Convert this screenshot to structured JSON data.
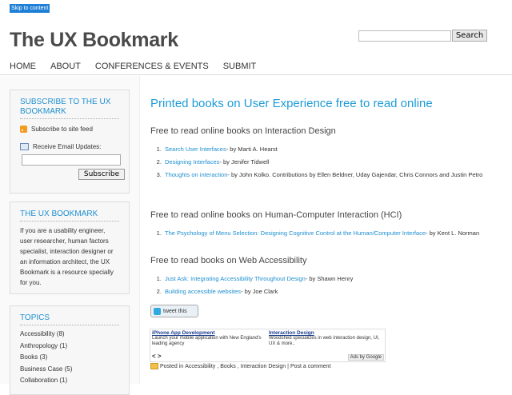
{
  "skip_link": "Skip to content",
  "header": {
    "title": "The UX Bookmark",
    "search_placeholder": "",
    "search_button": "Search"
  },
  "nav": [
    "HOME",
    "ABOUT",
    "CONFERENCES & EVENTS",
    "SUBMIT"
  ],
  "sidebar": {
    "subscribe": {
      "title": "SUBSCRIBE TO THE UX BOOKMARK",
      "feed": "Subscribe to site feed",
      "email": "Receive Email Updates:",
      "button": "Subscribe"
    },
    "about": {
      "title": "THE UX BOOKMARK",
      "text": "If you are a usability engineer, user researcher, human factors specialist, interaction designer or an information architect, the UX Bookmark is a resource specially for you."
    },
    "topics": {
      "title": "TOPICS",
      "items": [
        "Accessibility (8)",
        "Anthropology (1)",
        "Books (3)",
        "Business Case (5)",
        "Collaboration (1)"
      ]
    }
  },
  "main": {
    "title": "Printed books on User Experience free to read online",
    "sections": [
      {
        "heading": "Free to read online books on Interaction Design",
        "items": [
          {
            "link": "Search User Interfaces",
            "rest": "- by Marti A. Hearst"
          },
          {
            "link": "Designing Interfaces",
            "rest": "- by Jenifer Tidwell"
          },
          {
            "link": "Thoughts on interaction",
            "rest": "- by John Kolko. Contributions by Ellen Beldner, Uday Gajendar, Chris Connors and Justin Petro"
          }
        ]
      },
      {
        "heading": "Free to read online books on Human-Computer Interaction (HCI)",
        "items": [
          {
            "link": "The Psychology of Menu Selection: Designing Cognitive Control at the Human/Computer Interface",
            "rest": "- by Kent L. Norman"
          }
        ]
      },
      {
        "heading": "Free to read books on Web Accessibility",
        "items": [
          {
            "link": "Just Ask: Integrating Accessibility Throughout Design",
            "rest": "- by Shawn Henry"
          },
          {
            "link": "Building accessible websites",
            "rest": "- by Joe Clark"
          }
        ]
      }
    ],
    "tweet": "tweet this",
    "ads": [
      {
        "title": "iPhone App Development",
        "text": "Launch your mobile application with New England's leading agency"
      },
      {
        "title": "Interaction Design",
        "text": "Woodshed specializes in web interaction design, UI, UX & more.."
      }
    ],
    "ads_by": "Ads by Google",
    "posted": {
      "prefix": "Posted in",
      "cats": [
        "Accessibility",
        "Books",
        "Interaction Design"
      ],
      "sep": "|",
      "comment": "Post a comment"
    }
  }
}
